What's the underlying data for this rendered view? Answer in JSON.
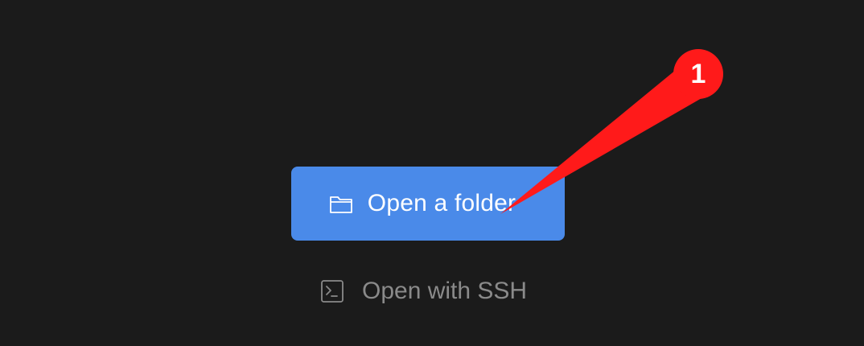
{
  "actions": {
    "primary_label": "Open a folder",
    "primary_icon": "folder-icon",
    "secondary_label": "Open with SSH",
    "secondary_icon": "terminal-icon"
  },
  "annotation": {
    "number": "1",
    "color": "#ff1a1a"
  },
  "colors": {
    "background": "#1b1b1b",
    "primary_button": "#4a8ae9",
    "secondary_text": "#8a8a8a"
  }
}
